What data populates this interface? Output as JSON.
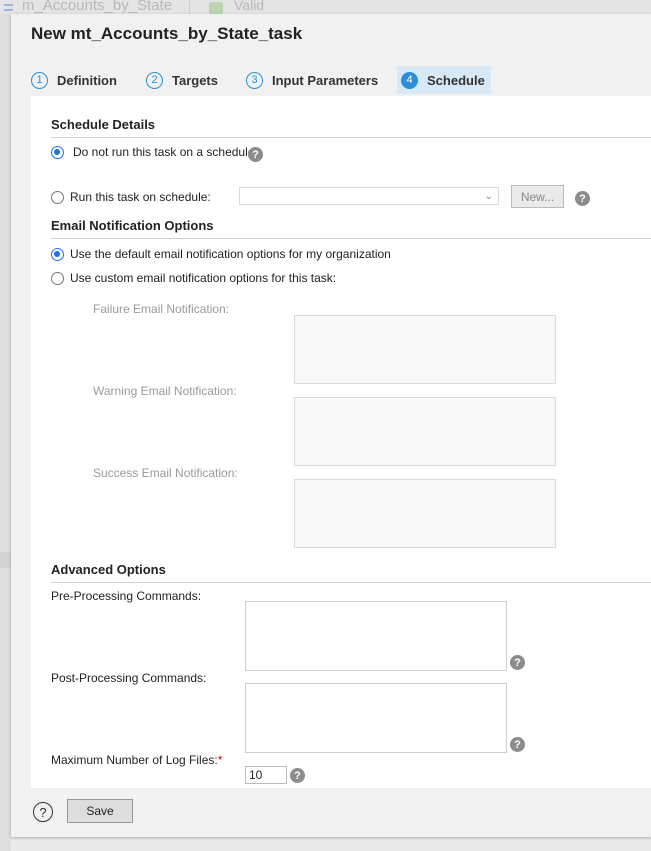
{
  "background": {
    "title": "m_Accounts_by_State",
    "status": "Valid"
  },
  "dialog": {
    "title": "New mt_Accounts_by_State_task"
  },
  "steps": [
    {
      "num": "1",
      "label": "Definition"
    },
    {
      "num": "2",
      "label": "Targets"
    },
    {
      "num": "3",
      "label": "Input Parameters"
    },
    {
      "num": "4",
      "label": "Schedule",
      "active": true
    }
  ],
  "schedule": {
    "heading": "Schedule Details",
    "no_schedule_label": "Do not run this task on a schedule",
    "run_schedule_label": "Run this task on schedule:",
    "select_value": "",
    "new_button": "New..."
  },
  "email": {
    "heading": "Email Notification Options",
    "default_label": "Use the default email notification options for my organization",
    "custom_label": "Use custom email notification options for this task:",
    "failure_label": "Failure Email Notification:",
    "warning_label": "Warning Email Notification:",
    "success_label": "Success Email Notification:"
  },
  "advanced": {
    "heading": "Advanced Options",
    "pre_label": "Pre-Processing Commands:",
    "post_label": "Post-Processing Commands:",
    "max_log_label": "Maximum Number of Log Files:",
    "required_mark": "*",
    "max_log_value": "10"
  },
  "footer": {
    "help": "?",
    "save_label": "Save"
  },
  "help_glyph": "?",
  "colors": {
    "accent": "#2a8fd8",
    "radio": "#1a73e8",
    "required": "#d0021b"
  }
}
